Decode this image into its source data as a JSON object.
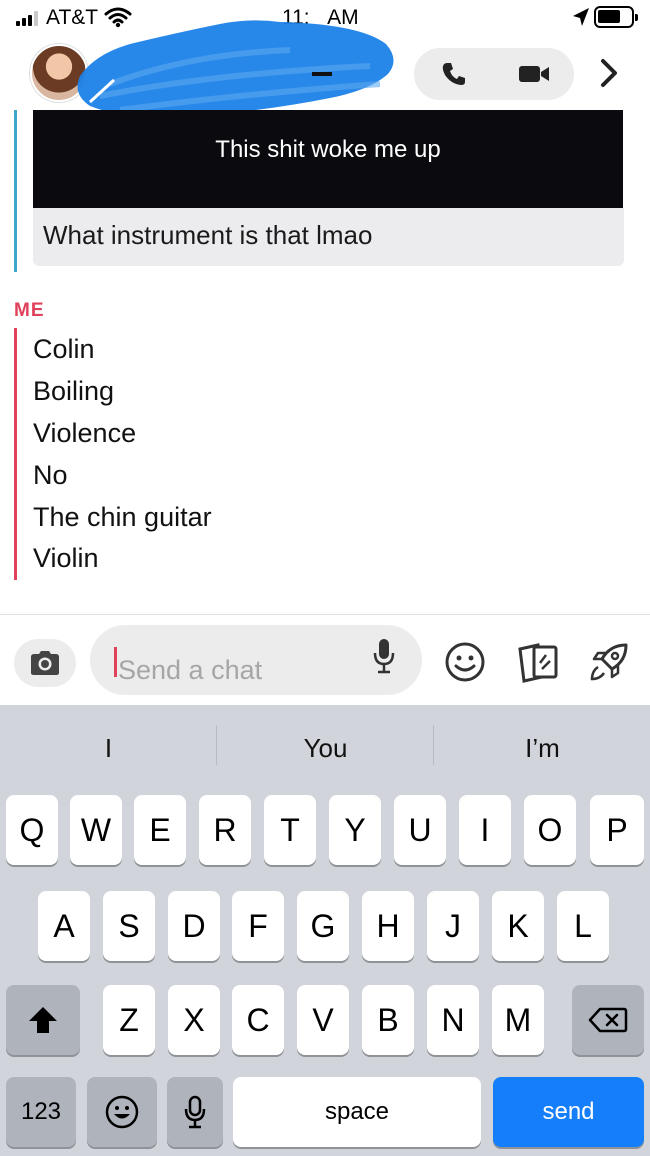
{
  "status_bar": {
    "carrier": "AT&T",
    "time": "11:   AM"
  },
  "header": {
    "icons": [
      "avatar",
      "phone-icon",
      "video-icon",
      "chevron-right-icon"
    ]
  },
  "messages": {
    "video_caption": "This shit woke me up",
    "friend_reply": "What instrument is that lmao",
    "me_label": "ME",
    "me_lines": [
      "Colin",
      "Boiling",
      "Violence",
      "No",
      "The chin guitar",
      "Violin"
    ]
  },
  "compose": {
    "placeholder": "Send a chat"
  },
  "keyboard": {
    "suggestions": [
      "I",
      "You",
      "I’m"
    ],
    "row1": [
      "Q",
      "W",
      "E",
      "R",
      "T",
      "Y",
      "U",
      "I",
      "O",
      "P"
    ],
    "row2": [
      "A",
      "S",
      "D",
      "F",
      "G",
      "H",
      "J",
      "K",
      "L"
    ],
    "row3": [
      "Z",
      "X",
      "C",
      "V",
      "B",
      "N",
      "M"
    ],
    "numbers_label": "123",
    "space_label": "space",
    "send_label": "send"
  },
  "colors": {
    "friend_accent": "#3fa7c9",
    "me_accent": "#e0415b",
    "send_key": "#147efb",
    "scribble": "#1c82e8"
  }
}
